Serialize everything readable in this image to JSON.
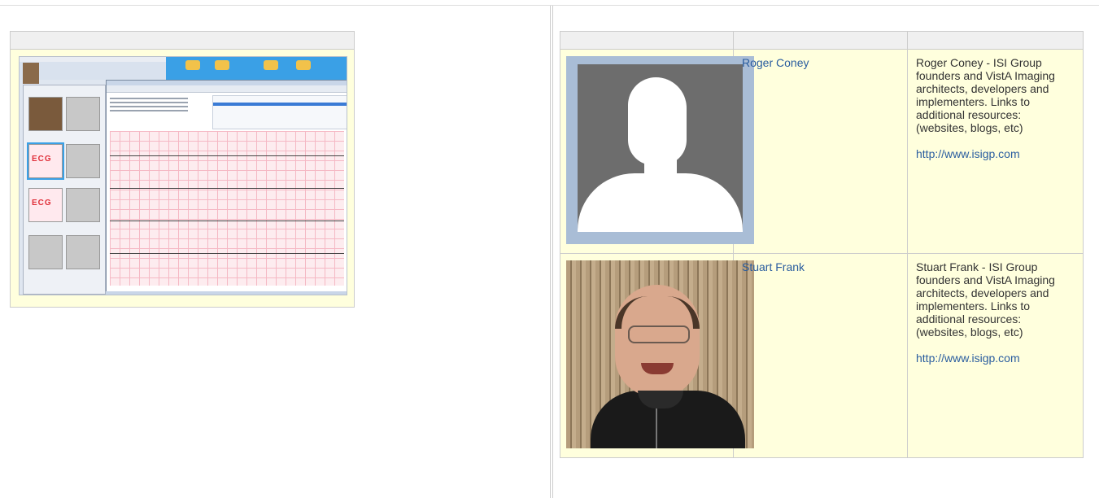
{
  "colors": {
    "header_bg": "#f0f0f0",
    "cell_bg": "#ffffdd",
    "border": "#cccccc",
    "link": "#2a5d9f",
    "text": "#333333"
  },
  "left_panel": {
    "table_header": "",
    "image_content": {
      "ecg_label_1": "ECG",
      "ecg_label_2": "ECG"
    }
  },
  "people_table": {
    "headers": [
      "",
      "",
      ""
    ],
    "rows": [
      {
        "photo_icon": "default-avatar-silhouette",
        "name": "Roger Coney",
        "description": "Roger Coney - ISI Group founders and VistA Imaging architects, developers and implementers. Links to additional resources: (websites, blogs, etc)",
        "link": "http://www.isigp.com"
      },
      {
        "photo_icon": "portrait-photo",
        "name": "Stuart Frank",
        "description": "Stuart Frank - ISI Group founders and VistA Imaging architects, developers and implementers. Links to additional resources: (websites, blogs, etc)",
        "link": "http://www.isigp.com"
      }
    ]
  }
}
